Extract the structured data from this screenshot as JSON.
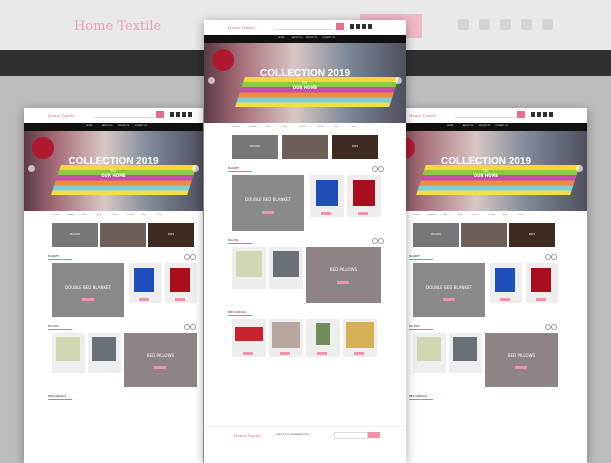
{
  "site": {
    "logo": "Home Textile",
    "hero_title": "COLLECTION 2019",
    "hero_for": "for",
    "hero_sub": "OUR HOME"
  },
  "nav_items": [
    "HOME",
    "ABOUT US",
    "PRODUCTS",
    "CONTACT US"
  ],
  "categories": [
    "Curtains",
    "Bedding",
    "Table",
    "Bath",
    "Kitchen",
    "Cushion",
    "Rugs",
    "Living"
  ],
  "tiles": [
    "PILLOWS",
    "",
    "MATS"
  ],
  "sections": {
    "blanket": "BLANKET",
    "pillows": "PILLOWS",
    "new_arrivals": "NEW ARRIVALS"
  },
  "features": {
    "double_bed_blanket": "DOUBLE BED BLANKET",
    "bed_pillows": "BED PILLOWS"
  },
  "footer": {
    "logo": "Home Textile",
    "newsletter": "SIGN UP FOR OUR NEWSLETTER!"
  },
  "colors": {
    "accent": "#e96e8a",
    "button": "#f391a8",
    "nav": "#111111"
  }
}
